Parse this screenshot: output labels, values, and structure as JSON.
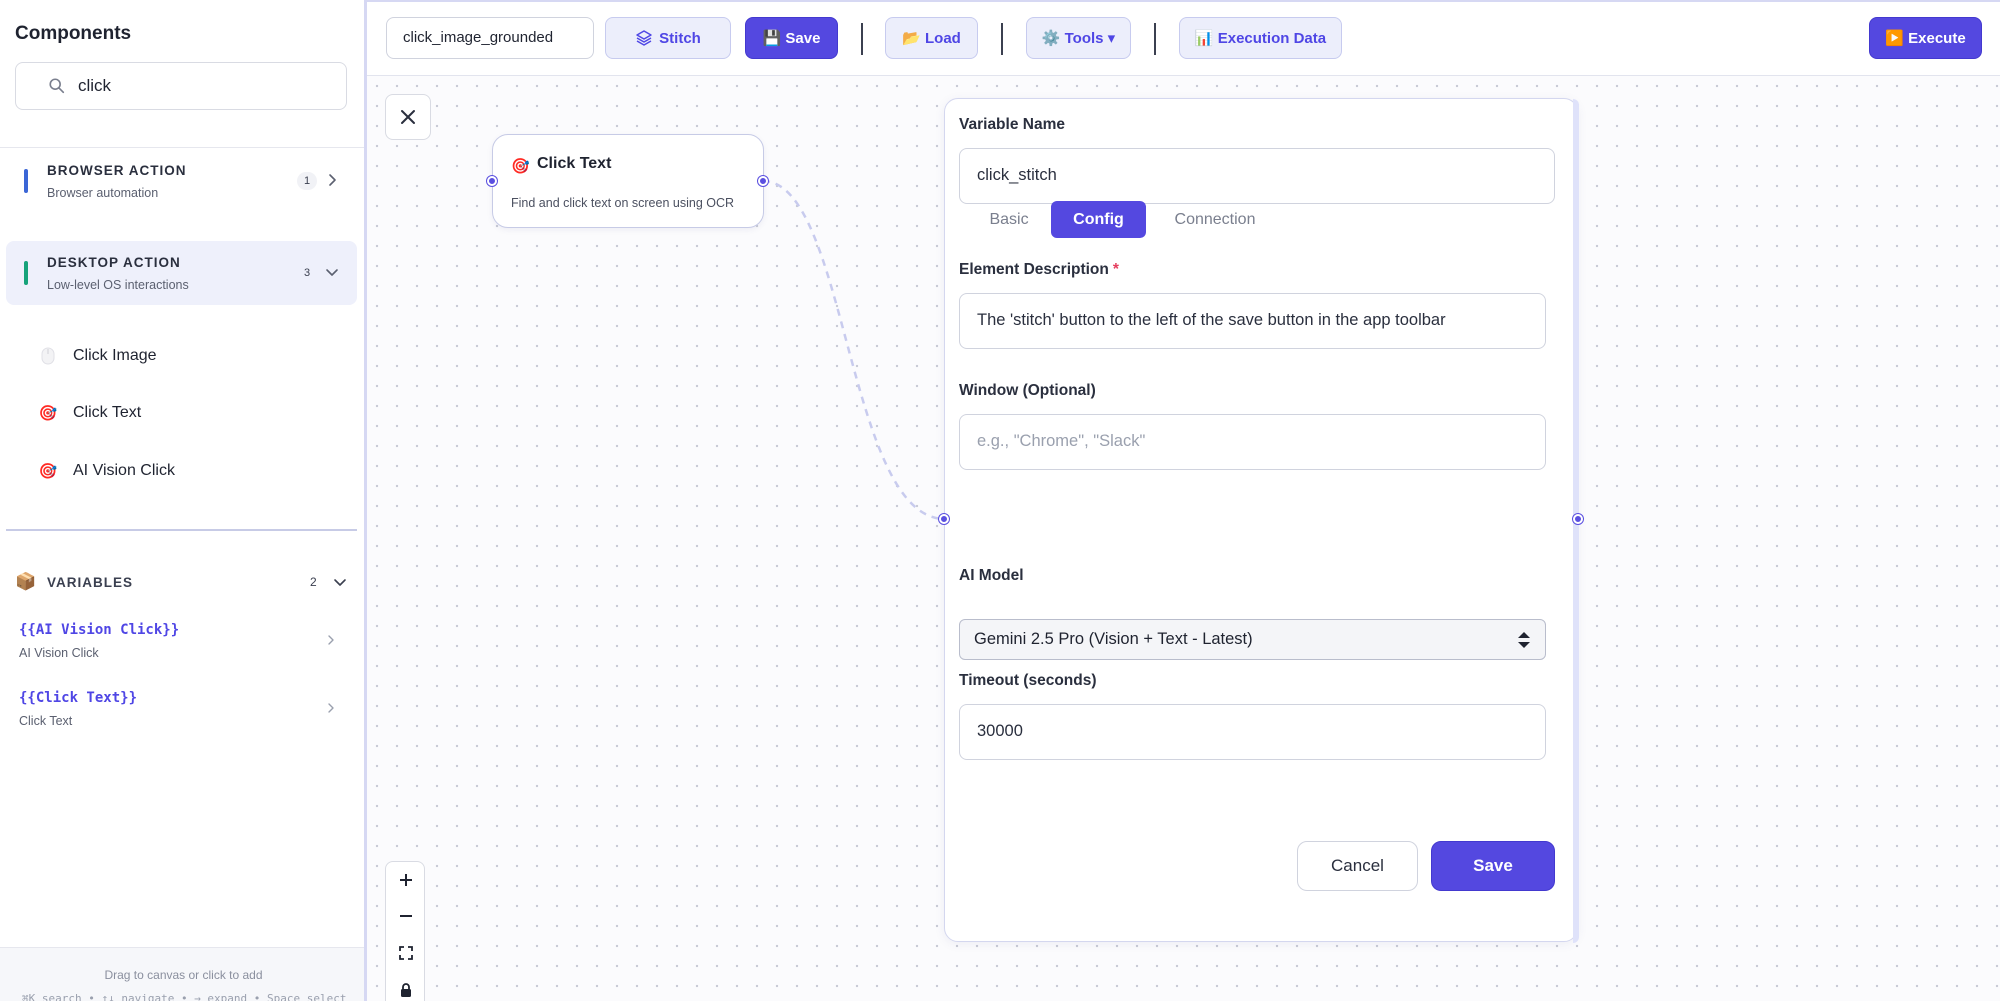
{
  "sidebar": {
    "title": "Components",
    "search": {
      "value": "click",
      "icon": "search-icon"
    },
    "categories": [
      {
        "name": "BROWSER ACTION",
        "description": "Browser automation",
        "count": "1",
        "color": "#3b66d6",
        "expanded": false
      },
      {
        "name": "DESKTOP ACTION",
        "description": "Low-level OS interactions",
        "count": "3",
        "color": "#16a37a",
        "expanded": true
      }
    ],
    "components": [
      {
        "label": "Click Image",
        "icon": "mouse-icon"
      },
      {
        "label": "Click Text",
        "icon": "target-icon"
      },
      {
        "label": "AI Vision Click",
        "icon": "target-icon"
      }
    ],
    "variables": {
      "title": "VARIABLES",
      "count": "2",
      "icon": "package-icon",
      "items": [
        {
          "token": "{{AI Vision Click}}",
          "source": "AI Vision Click"
        },
        {
          "token": "{{Click Text}}",
          "source": "Click Text"
        }
      ]
    },
    "footer": {
      "hint": "Drag to canvas or click to add",
      "keys": "⌘K search • ↑↓ navigate • → expand • Space select"
    }
  },
  "toolbar": {
    "workflow_name": "click_image_grounded",
    "stitch_label": "Stitch",
    "save_label": "💾 Save",
    "load_label": "📂 Load",
    "tools_label": "⚙️ Tools ▾",
    "execution_label": "📊 Execution Data",
    "execute_label": "▶️ Execute"
  },
  "canvas": {
    "node": {
      "title": "Click Text",
      "description": "Find and click text on screen using OCR",
      "icon": "target-icon"
    }
  },
  "panel": {
    "variable_name_label": "Variable Name",
    "variable_name_value": "click_stitch",
    "tabs": [
      "Basic",
      "Config",
      "Connection"
    ],
    "active_tab": "Config",
    "element_description_label": "Element Description",
    "required_mark": "*",
    "element_description_value": "The 'stitch' button to the left of the save button in the app toolbar",
    "window_label": "Window (Optional)",
    "window_placeholder": "e.g., \"Chrome\", \"Slack\"",
    "ai_model_label": "AI Model",
    "ai_model_value": "Gemini 2.5 Pro (Vision + Text - Latest)",
    "timeout_label": "Timeout (seconds)",
    "timeout_value": "30000",
    "cancel_label": "Cancel",
    "save_label": "Save"
  },
  "colors": {
    "accent": "#5448e0",
    "accent_light": "#eceefb",
    "browser_category": "#3b66d6",
    "desktop_category": "#16a37a",
    "required": "#e53e5e"
  }
}
